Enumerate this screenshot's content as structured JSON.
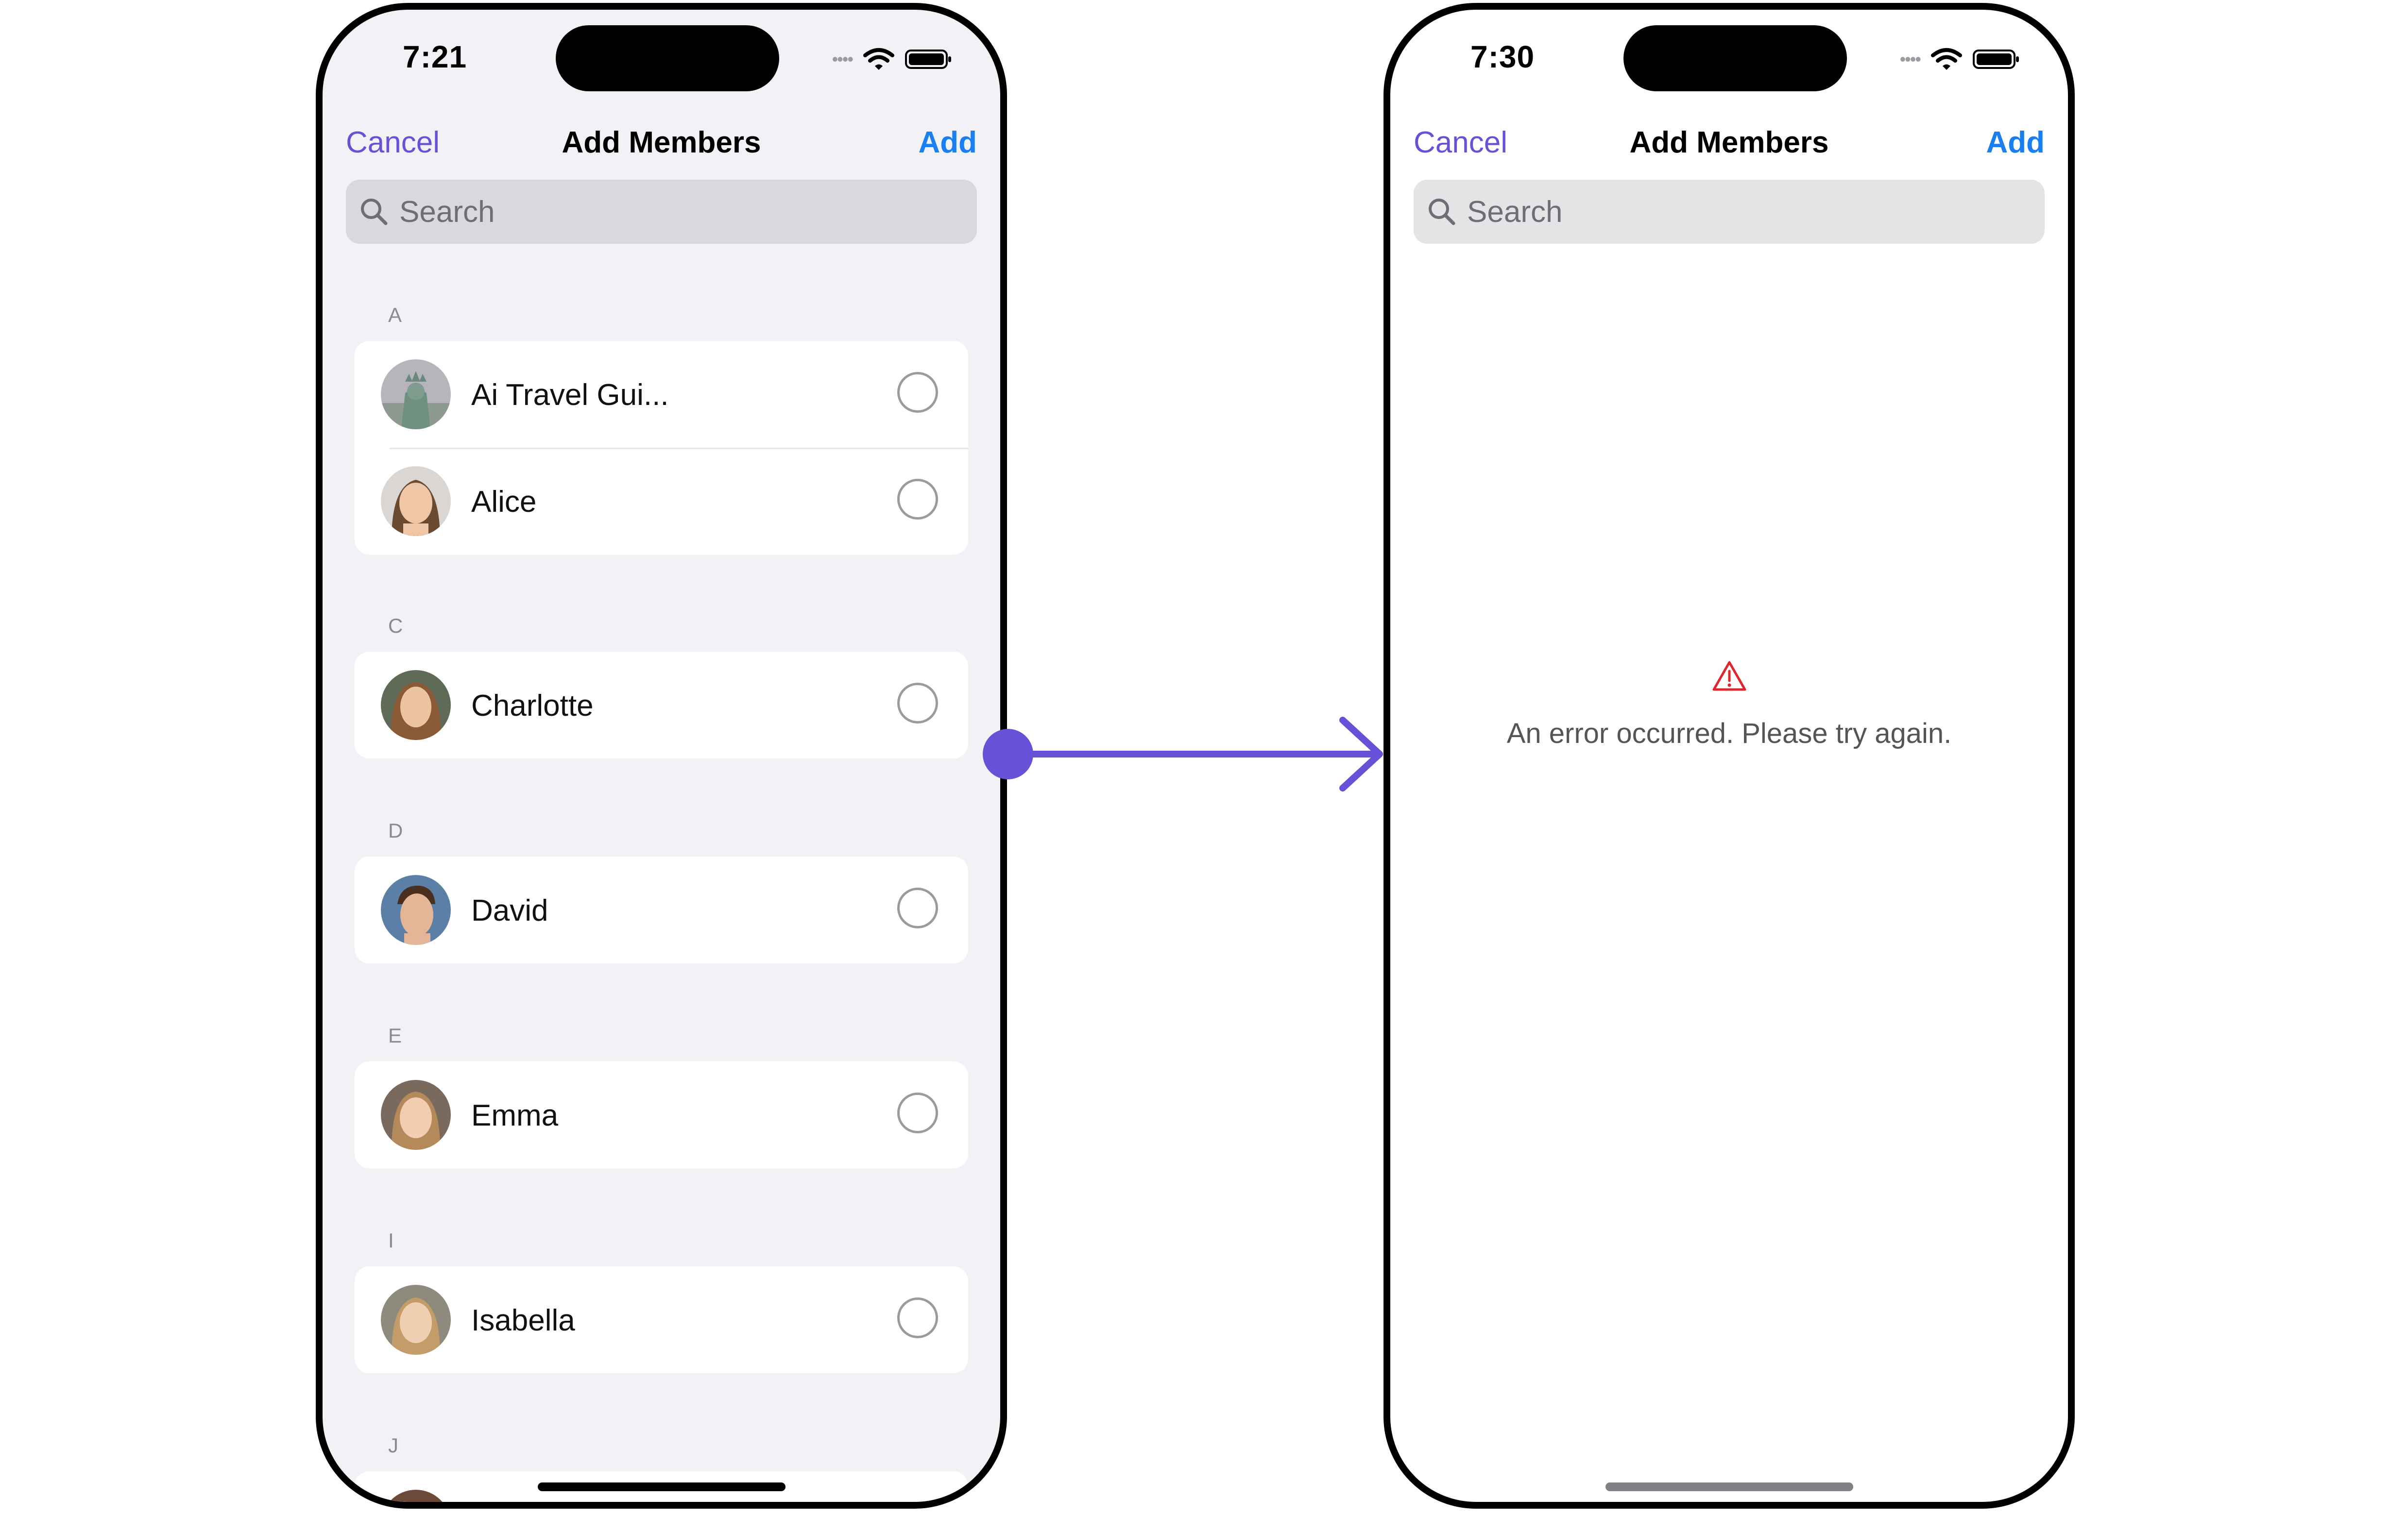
{
  "left_screen": {
    "status_time": "7:21",
    "nav": {
      "cancel_label": "Cancel",
      "title": "Add Members",
      "add_label": "Add"
    },
    "search_placeholder": "Search",
    "sections": [
      {
        "letter": "A",
        "members": [
          {
            "name": "Ai Travel Gui...",
            "selected": false
          },
          {
            "name": "Alice",
            "selected": false
          }
        ]
      },
      {
        "letter": "C",
        "members": [
          {
            "name": "Charlotte",
            "selected": false
          }
        ]
      },
      {
        "letter": "D",
        "members": [
          {
            "name": "David",
            "selected": false
          }
        ]
      },
      {
        "letter": "E",
        "members": [
          {
            "name": "Emma",
            "selected": false
          }
        ]
      },
      {
        "letter": "I",
        "members": [
          {
            "name": "Isabella",
            "selected": false
          }
        ]
      },
      {
        "letter": "J",
        "members": []
      }
    ]
  },
  "right_screen": {
    "status_time": "7:30",
    "nav": {
      "cancel_label": "Cancel",
      "title": "Add Members",
      "add_label": "Add"
    },
    "search_placeholder": "Search",
    "error_message": "An error occurred. Please try again."
  },
  "colors": {
    "accent_purple": "#6851d6",
    "add_blue": "#1a7ff0",
    "error_red": "#e0262d",
    "connector": "#6851d6"
  },
  "icons": [
    "search-icon",
    "wifi-icon",
    "battery-icon",
    "warning-icon",
    "arrow-right-icon"
  ]
}
